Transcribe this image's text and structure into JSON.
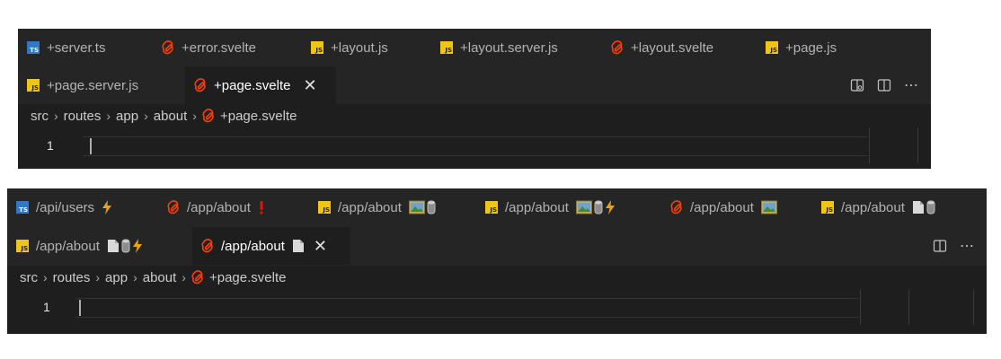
{
  "panels": [
    {
      "tabs_row1": [
        {
          "label": "+server.ts",
          "icon": "ts"
        },
        {
          "label": "+error.svelte",
          "icon": "svelte"
        },
        {
          "label": "+layout.js",
          "icon": "js"
        },
        {
          "label": "+layout.server.js",
          "icon": "js"
        },
        {
          "label": "+layout.svelte",
          "icon": "svelte"
        },
        {
          "label": "+page.js",
          "icon": "js"
        }
      ],
      "tabs_row2": [
        {
          "label": "+page.server.js",
          "icon": "js"
        },
        {
          "label": "+page.svelte",
          "icon": "svelte",
          "active": true
        }
      ],
      "breadcrumb": [
        "src",
        "routes",
        "app",
        "about",
        "+page.svelte"
      ],
      "line_number": "1"
    },
    {
      "tabs_row1": [
        {
          "label": "/api/users",
          "icon": "ts",
          "decor": [
            "bolt"
          ]
        },
        {
          "label": "/app/about",
          "icon": "svelte",
          "decor": [
            "exclaim"
          ]
        },
        {
          "label": "/app/about",
          "icon": "js",
          "decor": [
            "image",
            "cylinder"
          ]
        },
        {
          "label": "/app/about",
          "icon": "js",
          "decor": [
            "image",
            "cylinder",
            "bolt"
          ]
        },
        {
          "label": "/app/about",
          "icon": "svelte",
          "decor": [
            "image"
          ]
        },
        {
          "label": "/app/about",
          "icon": "js",
          "decor": [
            "page",
            "cylinder"
          ]
        }
      ],
      "tabs_row2": [
        {
          "label": "/app/about",
          "icon": "js",
          "decor": [
            "page",
            "cylinder",
            "bolt"
          ]
        },
        {
          "label": "/app/about",
          "icon": "svelte",
          "decor": [
            "page"
          ],
          "active": true
        }
      ],
      "breadcrumb": [
        "src",
        "routes",
        "app",
        "about",
        "+page.svelte"
      ],
      "line_number": "1"
    }
  ],
  "colors": {
    "tabbar_bg": "#252526",
    "editor_bg": "#1e1e1e",
    "svelte": "#ff3e00",
    "typescript": "#3178c6",
    "javascript": "#f0c419",
    "bolt": "#e8a317",
    "exclaim": "#e51400"
  },
  "icons": {
    "ts": "typescript-file-icon",
    "js": "javascript-file-icon",
    "svelte": "svelte-file-icon",
    "close": "close-icon",
    "more": "more-actions-icon",
    "split": "split-editor-icon",
    "preview": "open-preview-icon",
    "chevron": "chevron-right-icon"
  }
}
